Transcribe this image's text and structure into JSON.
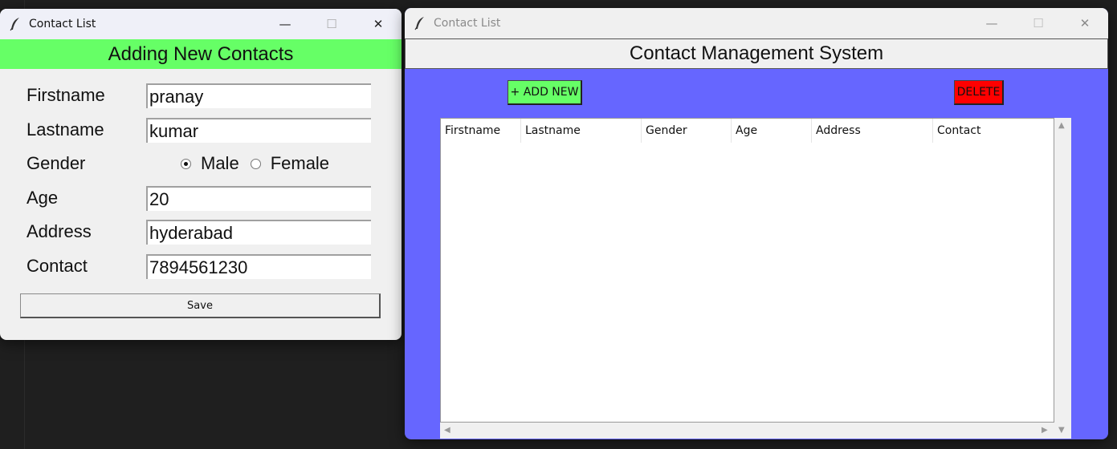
{
  "add_window": {
    "title": "Contact List",
    "header": "Adding New Contacts",
    "fields": {
      "firstname": {
        "label": "Firstname",
        "value": "pranay"
      },
      "lastname": {
        "label": "Lastname",
        "value": "kumar"
      },
      "gender": {
        "label": "Gender",
        "options": [
          "Male",
          "Female"
        ],
        "selected": "Male"
      },
      "age": {
        "label": "Age",
        "value": "20"
      },
      "address": {
        "label": "Address",
        "value": "hyderabad"
      },
      "contact": {
        "label": "Contact",
        "value": "7894561230"
      }
    },
    "save_label": "Save",
    "controls": {
      "minimize": "—",
      "maximize": "☐",
      "close": "✕"
    }
  },
  "list_window": {
    "title": "Contact List",
    "header": "Contact Management System",
    "add_button": "+ ADD NEW",
    "delete_button": "DELETE",
    "columns": [
      "Firstname",
      "Lastname",
      "Gender",
      "Age",
      "Address",
      "Contact"
    ],
    "rows": [],
    "controls": {
      "minimize": "—",
      "maximize": "☐",
      "close": "✕"
    }
  },
  "colors": {
    "add_header_bg": "#66ff66",
    "list_bg": "#6666ff",
    "add_button_bg": "#66ff66",
    "delete_button_bg": "#ff0000"
  },
  "icons": {
    "app_icon": "feather-icon",
    "radio": "radio-button-icon"
  }
}
